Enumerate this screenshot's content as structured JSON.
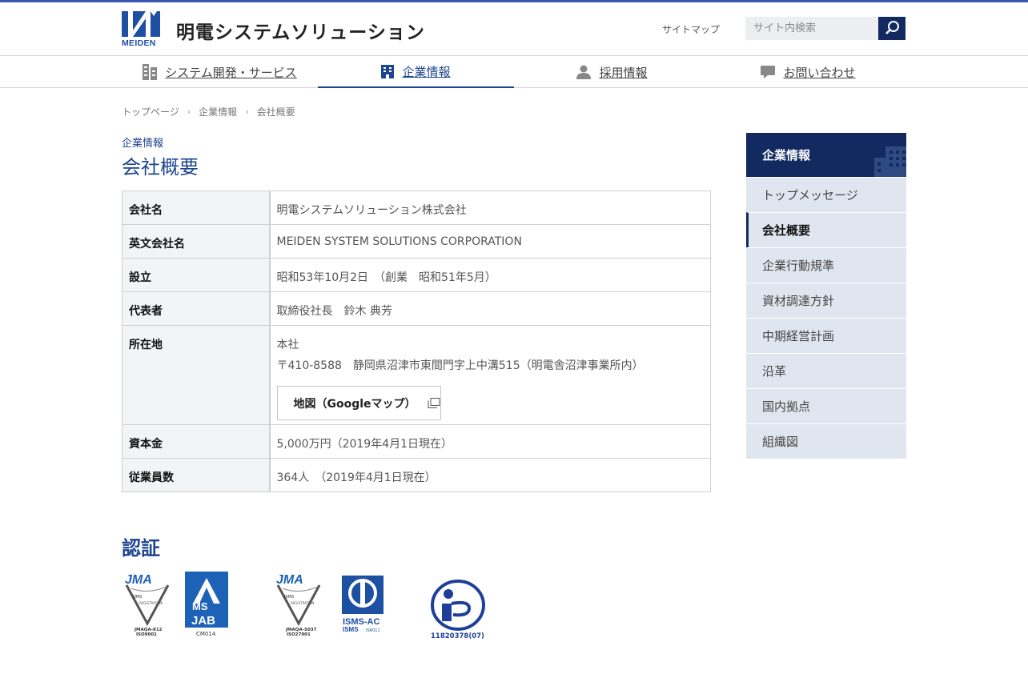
{
  "header": {
    "logo_text": "MEIDEN",
    "company_name": "明電システムソリューション",
    "sitemap_label": "サイトマップ",
    "search_placeholder": "サイト内検索",
    "accent_color": "#1d4590",
    "dark_color": "#122a5f"
  },
  "gnav": [
    {
      "label": "システム開発・サービス",
      "icon": "document-stack-icon"
    },
    {
      "label": "企業情報",
      "icon": "building-icon",
      "active": true
    },
    {
      "label": "採用情報",
      "icon": "person-icon"
    },
    {
      "label": "お問い合わせ",
      "icon": "speech-bubble-icon"
    }
  ],
  "breadcrumb": [
    "トップページ",
    "企業情報",
    "会社概要"
  ],
  "page": {
    "category": "企業情報",
    "title": "会社概要"
  },
  "table": {
    "rows": [
      {
        "label": "会社名",
        "value": "明電システムソリューション株式会社"
      },
      {
        "label": "英文会社名",
        "value": "MEIDEN SYSTEM SOLUTIONS CORPORATION"
      },
      {
        "label": "設立",
        "value": "昭和53年10月2日　（創業　昭和51年5月）"
      },
      {
        "label": "代表者",
        "value": "取締役社長　鈴木 典芳"
      },
      {
        "label": "所在地",
        "value": "本社",
        "value2": "〒410-8588　静岡県沼津市東間門字上中溝515（明電舎沼津事業所内）",
        "button": "地図（Googleマップ）"
      },
      {
        "label": "資本金",
        "value": "5,000万円（2019年4月1日現在）"
      },
      {
        "label": "従業員数",
        "value": "364人　（2019年4月1日現在）"
      }
    ]
  },
  "certification": {
    "title": "認証",
    "badges": {
      "jma_qms": {
        "name": "jma-qms-logo",
        "code": "JMAQA-812",
        "std": "ISO9001"
      },
      "ms_jab": {
        "name": "ms-jab-logo",
        "code": "CM014"
      },
      "jma_isms": {
        "name": "jma-isms-logo",
        "code": "JMAQA-S037",
        "std": "ISO27001"
      },
      "isms_ac": {
        "name": "isms-ac-logo",
        "code": "ISR011"
      },
      "privacy": {
        "name": "privacy-mark-logo",
        "code": "11820378(07)"
      }
    }
  },
  "sidebar": {
    "heading": "企業情報",
    "items": [
      {
        "label": "トップメッセージ"
      },
      {
        "label": "会社概要",
        "active": true
      },
      {
        "label": "企業行動規準"
      },
      {
        "label": "資材調達方針"
      },
      {
        "label": "中期経営計画"
      },
      {
        "label": "沿革"
      },
      {
        "label": "国内拠点"
      },
      {
        "label": "組織図"
      }
    ]
  }
}
